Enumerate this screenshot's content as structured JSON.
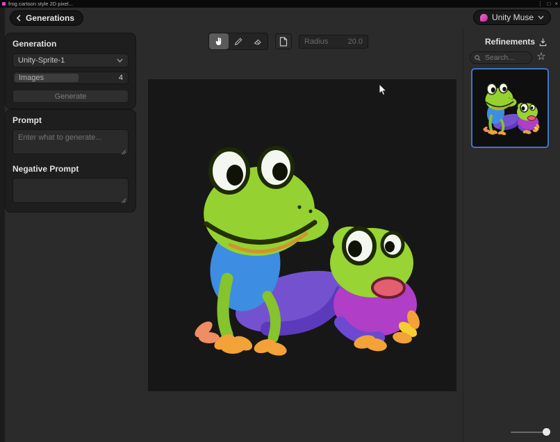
{
  "window": {
    "title": "frog cartoon style 2D pixel...",
    "controls": {
      "menu": "⋮",
      "maximize": "□",
      "close": "×"
    }
  },
  "header": {
    "back_label": "Generations",
    "muse_label": "Unity Muse"
  },
  "generation": {
    "title": "Generation",
    "model_value": "Unity-Sprite-1",
    "images_label": "Images",
    "images_value": "4",
    "generate_label": "Generate"
  },
  "prompt": {
    "label": "Prompt",
    "placeholder": "Enter what to generate...",
    "negative_label": "Negative Prompt"
  },
  "toolbar": {
    "tools": [
      "pan",
      "brush",
      "eraser",
      "clear"
    ],
    "active_tool": "pan",
    "radius_label": "Radius",
    "radius_value": "20.0"
  },
  "refinements": {
    "title": "Refinements",
    "search_placeholder": "Search...",
    "star_glyph": "☆"
  },
  "colors": {
    "selection_blue": "#3c78c8",
    "muse_pink": "#d84bc8",
    "canvas_bg": "#171717",
    "panel_bg": "#1e1e1e",
    "window_bg": "#2b2b2b"
  }
}
